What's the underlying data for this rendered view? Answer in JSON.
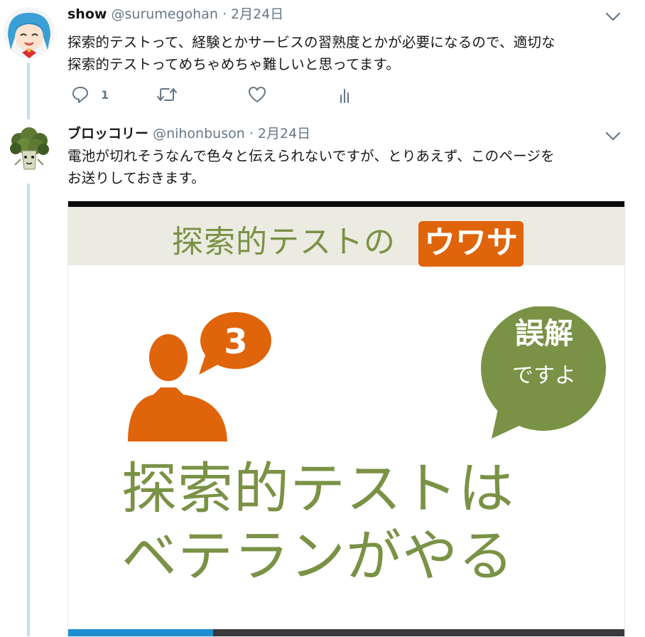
{
  "tweets": [
    {
      "name": "show",
      "handle": "@surumegohan",
      "time": "· 2月24日",
      "text_lines": [
        "探索的テストって、経験とかサービスの習熟度とかが必要になるので、適切な",
        "探索的テストってめちゃめちゃ難しいと思ってます。"
      ],
      "reply_count": "1"
    },
    {
      "name": "ブロッコリー",
      "handle": "@nihonbuson",
      "time": "· 2月24日",
      "text_lines": [
        "電池が切れそうなんで色々と伝えられないですが、とりあえず、このページを",
        "お送りしておきます。"
      ]
    }
  ],
  "card": {
    "band_text": "探索的テストの",
    "band_badge": "ウワサ",
    "number": "3",
    "bubble_main": "誤解",
    "bubble_sub": "ですよ",
    "headline_1": "探索的テストは",
    "headline_2": "ベテランがやる",
    "progress": 0.26
  },
  "colors": {
    "thread_line": "#bfe0f2",
    "accent_orange": "#e0640a",
    "accent_green": "#7a9245",
    "icon_gray": "#657786"
  },
  "icons": [
    "reply-icon",
    "retweet-icon",
    "like-icon",
    "analytics-icon",
    "chevron-down-icon"
  ]
}
